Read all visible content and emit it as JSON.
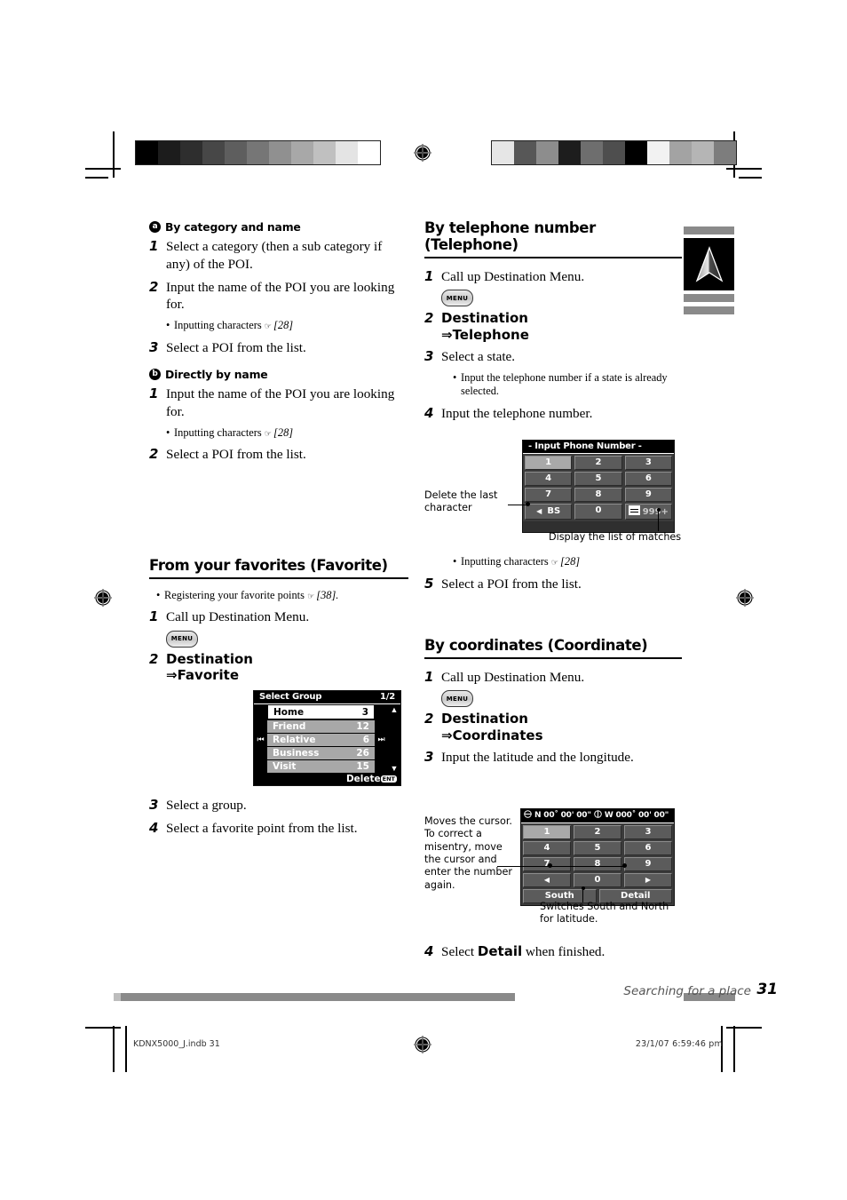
{
  "document": {
    "footer_title": "Searching for a place",
    "page_number": "31",
    "slug_left": "KDNX5000_J.indb   31",
    "slug_right": "23/1/07   6:59:46 pm"
  },
  "left_column": {
    "section_a": {
      "marker": "a",
      "heading": "By category and name",
      "steps": [
        {
          "num": "1",
          "text": "Select a category (then a sub category if any) of the POI."
        },
        {
          "num": "2",
          "text": "Input the name of the POI you are looking for."
        },
        {
          "num": "3",
          "text": "Select a POI from the list."
        }
      ],
      "bullet": {
        "text": "Inputting characters",
        "hand": "☞",
        "ref": "[28]"
      }
    },
    "section_b": {
      "marker": "b",
      "heading": "Directly by name",
      "steps": [
        {
          "num": "1",
          "text": "Input the name of the POI you are looking for."
        },
        {
          "num": "2",
          "text": "Select a POI from the list."
        }
      ],
      "bullet": {
        "text": "Inputting characters",
        "hand": "☞",
        "ref": "[28]"
      }
    },
    "favorite": {
      "heading_plain": "From your favorites (",
      "heading_literal": "Favorite",
      "heading_close": ")",
      "bullet": {
        "text": "Registering your favorite points",
        "hand": "☞",
        "ref": "[38]."
      },
      "step1": {
        "num": "1",
        "text": "Call up Destination Menu."
      },
      "menu_button": "MENU",
      "step2": {
        "num": "2",
        "line1": "Destination",
        "line2": "⇒Favorite"
      },
      "step3": {
        "num": "3",
        "text": "Select a group."
      },
      "step4": {
        "num": "4",
        "text": "Select a favorite point from the list."
      },
      "lcd": {
        "title": "Select Group",
        "page": "1/2",
        "prev_icon": "⏮",
        "next_icon": "⏭",
        "scroll_up_icon": "▲",
        "scroll_down_icon": "▼",
        "rows": [
          {
            "name": "Home",
            "count": "3",
            "selected": true
          },
          {
            "name": "Friend",
            "count": "12",
            "selected": false
          },
          {
            "name": "Relative",
            "count": "6",
            "selected": false
          },
          {
            "name": "Business",
            "count": "26",
            "selected": false
          },
          {
            "name": "Visit",
            "count": "15",
            "selected": false
          }
        ],
        "delete_label": "Delete",
        "delete_badge": "ENT"
      }
    }
  },
  "right_column": {
    "telephone": {
      "heading_plain": "By telephone number (",
      "heading_literal": "Telephone",
      "heading_close": ")",
      "step1": {
        "num": "1",
        "text": "Call up Destination Menu."
      },
      "menu_button": "MENU",
      "step2": {
        "num": "2",
        "line1": "Destination",
        "line2": "⇒Telephone"
      },
      "step3": {
        "num": "3",
        "text": "Select a state."
      },
      "step3_bullet": "Input the telephone number if a state is already selected.",
      "step4": {
        "num": "4",
        "text": "Input the telephone number."
      },
      "lcd": {
        "title": "- Input Phone Number -",
        "keys_row1": [
          "1",
          "2",
          "3"
        ],
        "keys_row2": [
          "4",
          "5",
          "6"
        ],
        "keys_row3": [
          "7",
          "8",
          "9"
        ],
        "backspace_label": "BS",
        "backspace_arrow": "◀",
        "zero_label": "0",
        "matches_label": "999+"
      },
      "callout_delete": "Delete the last\ncharacter",
      "callout_matches": "Display the list of matches",
      "bullet": {
        "text": "Inputting characters",
        "hand": "☞",
        "ref": "[28]"
      },
      "step5": {
        "num": "5",
        "text": "Select a POI from the list."
      }
    },
    "coordinate": {
      "heading_plain": "By coordinates (",
      "heading_literal": "Coordinate",
      "heading_close": ")",
      "step1": {
        "num": "1",
        "text": "Call up Destination Menu."
      },
      "menu_button": "MENU",
      "step2": {
        "num": "2",
        "line1": "Destination",
        "line2": "⇒Coordinates"
      },
      "step3": {
        "num": "3",
        "text": "Input the latitude and the longitude."
      },
      "lcd": {
        "latitude": "N 00˚ 00' 00\"",
        "longitude": "W 000˚ 00' 00\"",
        "keys_row1": [
          "1",
          "2",
          "3"
        ],
        "keys_row2": [
          "4",
          "5",
          "6"
        ],
        "keys_row3": [
          "7",
          "8",
          "9"
        ],
        "left_arrow": "◀",
        "zero_label": "0",
        "right_arrow": "▶",
        "south_label": "South",
        "detail_label": "Detail"
      },
      "callout_cursor": "Moves the cursor.\nTo correct a\nmisentry, move\nthe cursor and\nenter the number\nagain.",
      "callout_south": "Switches South and North\nfor latitude.",
      "step4_pre": "Select ",
      "step4_literal": "Detail",
      "step4_post": " when finished.",
      "step4_num": "4"
    }
  },
  "nav_tab": {
    "icon": "navigation-arrow-icon"
  },
  "calibration": {
    "left_bar": [
      "#000000",
      "#1c1c1c",
      "#2e2e2e",
      "#474747",
      "#5e5e5e",
      "#767676",
      "#909090",
      "#a8a8a8",
      "#c0c0c0",
      "#e4e4e4",
      "#ffffff"
    ],
    "right_bar": [
      "#e6e6e6",
      "#575757",
      "#8d8d8d",
      "#1d1d1d",
      "#6e6e6e",
      "#4e4e4e",
      "#000000",
      "#f2f2f2",
      "#a3a3a3",
      "#b5b5b5",
      "#7d7d7d"
    ]
  }
}
